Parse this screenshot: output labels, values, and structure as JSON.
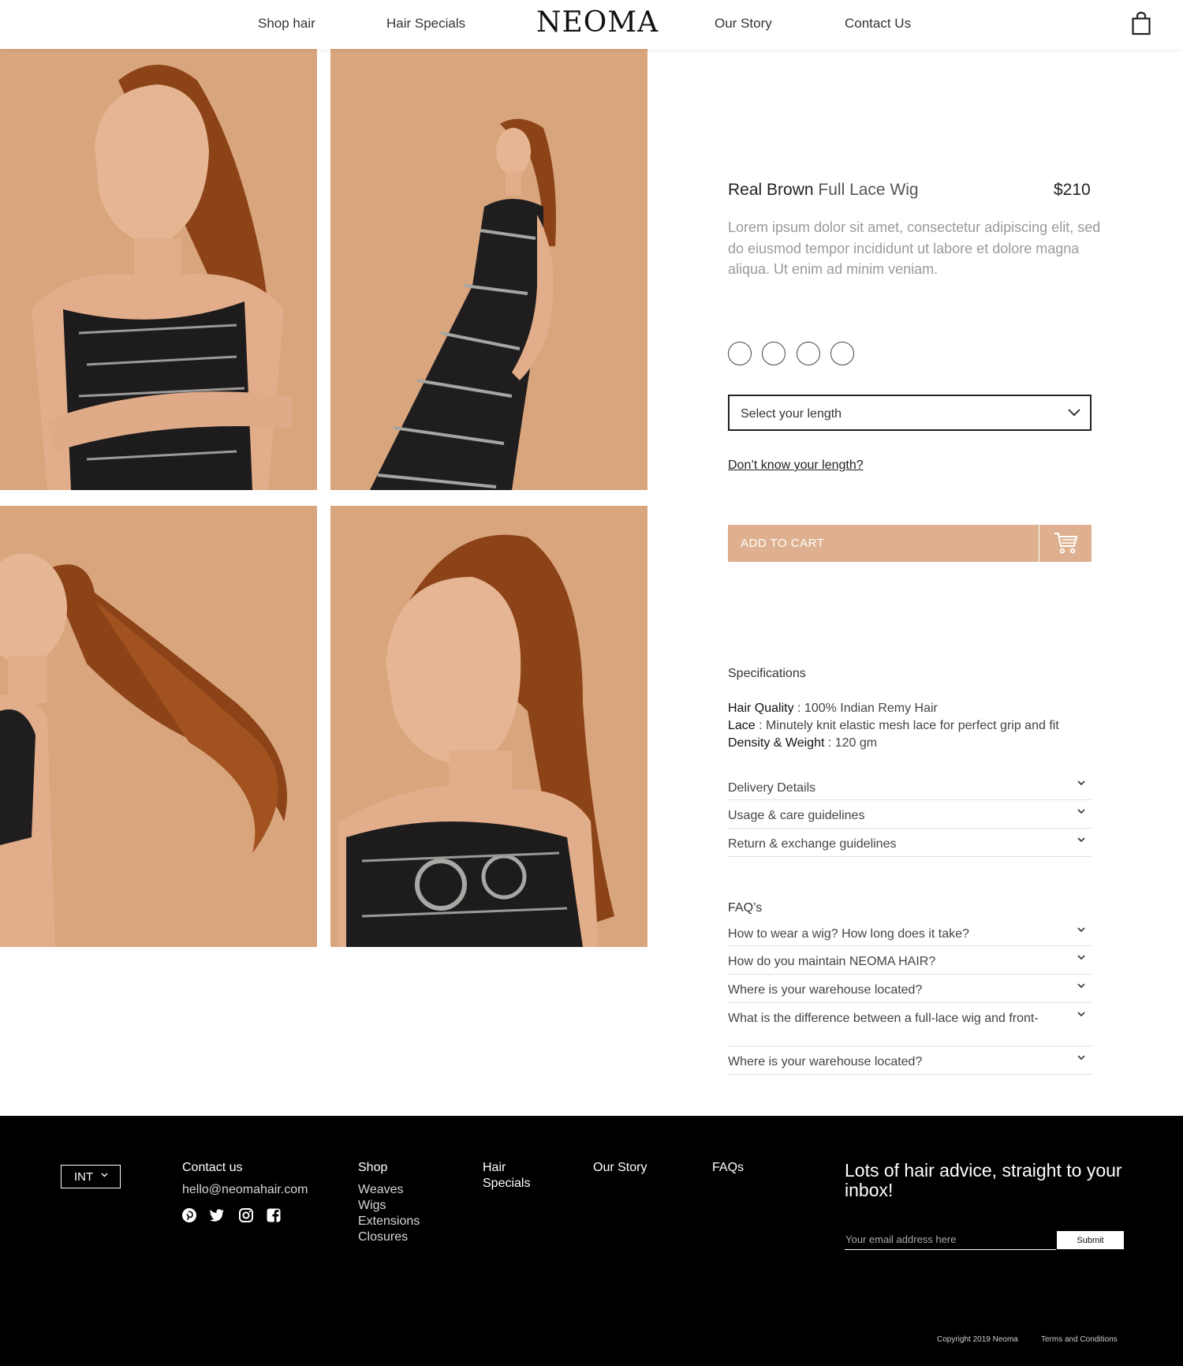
{
  "header": {
    "nav_left": [
      "Shop hair",
      "Hair Specials"
    ],
    "logo": "NEOMA",
    "nav_right": [
      "Our Story",
      "Contact Us"
    ],
    "cart_icon": "shopping-bag-icon"
  },
  "gallery": {
    "photos": [
      {
        "name": "model-portrait-arms-crossed"
      },
      {
        "name": "model-full-length-dress"
      },
      {
        "name": "model-hair-swing"
      },
      {
        "name": "model-profile-closeup"
      }
    ]
  },
  "product": {
    "title_bold": "Real Brown",
    "title_rest": " Full Lace Wig",
    "price": "$210",
    "description": "Lorem ipsum dolor sit amet, consectetur adipiscing elit, sed do eiusmod tempor incididunt ut labore et dolore magna aliqua. Ut enim ad minim veniam.",
    "swatch_count": 4,
    "length_select": "Select your length",
    "length_help": "Don’t know your length?",
    "add_to_cart": "ADD TO CART",
    "cart_icon": "cart-icon"
  },
  "specifications": {
    "heading": "Specifications",
    "items": [
      {
        "key": "Hair Quality",
        "value": " : 100% Indian Remy Hair"
      },
      {
        "key": "Lace",
        "value": " : Minutely knit elastic mesh lace for perfect grip and fit"
      },
      {
        "key": "Density & Weight",
        "value": " : 120 gm"
      }
    ],
    "accordions": [
      "Delivery Details",
      "Usage & care guidelines",
      "Return & exchange guidelines"
    ]
  },
  "faqs": {
    "heading": "FAQ’s",
    "items": [
      "How to wear a wig? How long does it take?",
      "How do you maintain NEOMA HAIR?",
      "Where is your warehouse located?",
      "What is the difference between a full-lace wig and front-",
      "Where is your warehouse located?"
    ]
  },
  "footer": {
    "region": "INT",
    "contact_heading": "Contact us",
    "email": "hello@neomahair.com",
    "social_icons": [
      "pinterest-icon",
      "twitter-icon",
      "instagram-icon",
      "facebook-icon"
    ],
    "shop_heading": "Shop",
    "shop_links": [
      "Weaves",
      "Wigs",
      "Extensions",
      "Closures"
    ],
    "hair_specials_line1": "Hair",
    "hair_specials_line2": "Specials",
    "our_story": "Our Story",
    "faqs": "FAQs",
    "newsletter_title": "Lots of hair advice, straight to your inbox!",
    "email_placeholder": "Your email address here",
    "submit": "Submit",
    "copyright": "Copyright 2019 Neoma",
    "terms": "Terms and Conditions"
  },
  "colors": {
    "accent": "#deb08f",
    "photo_background": "#d9a57d",
    "footer_background": "#000000"
  }
}
